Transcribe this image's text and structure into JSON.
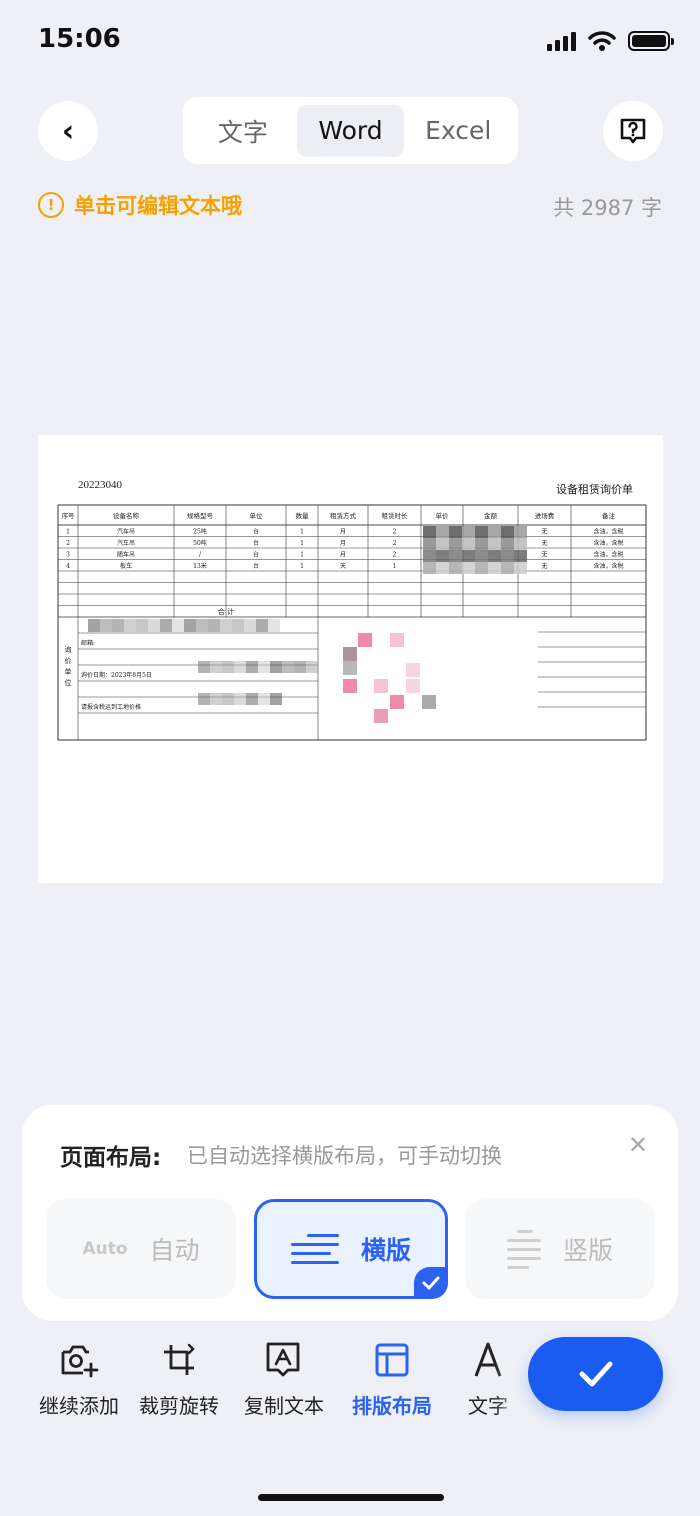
{
  "status": {
    "time": "15:06"
  },
  "header": {
    "tabs": [
      {
        "label": "文字",
        "active": false
      },
      {
        "label": "Word",
        "active": true
      },
      {
        "label": "Excel",
        "active": false
      }
    ]
  },
  "hint": {
    "text": "单击可编辑文本哦",
    "count": "共 2987 字"
  },
  "document": {
    "code": "20223040",
    "title": "设备租赁询价单",
    "headers": [
      "序号",
      "设备名称",
      "规格型号",
      "单位",
      "数量",
      "租赁方式",
      "租赁时长",
      "单价",
      "金额",
      "进场费",
      "备注"
    ],
    "rows": [
      [
        "1",
        "汽车吊",
        "25吨",
        "台",
        "1",
        "月",
        "2",
        "",
        "",
        "无",
        "含油，含税"
      ],
      [
        "2",
        "汽车吊",
        "50吨",
        "台",
        "1",
        "月",
        "2",
        "",
        "",
        "无",
        "含油，含税"
      ],
      [
        "3",
        "随车吊",
        "/",
        "台",
        "1",
        "月",
        "2",
        "",
        "",
        "无",
        "含油，含税"
      ],
      [
        "4",
        "板车",
        "13米",
        "台",
        "1",
        "天",
        "1",
        "",
        "",
        "无",
        "含油，含税"
      ]
    ],
    "total_label": "合      计",
    "inquiry_label": "询价单位",
    "email_label": "邮箱:",
    "date_label": "询价日期：2023年8月5日",
    "note": "请报含税运到工地价格"
  },
  "layout_panel": {
    "title": "页面布局:",
    "subtitle": "已自动选择横版布局，可手动切换",
    "options": [
      {
        "tag": "Auto",
        "label": "自动",
        "selected": false
      },
      {
        "label": "横版",
        "selected": true
      },
      {
        "label": "竖版",
        "selected": false
      }
    ]
  },
  "toolbar": {
    "items": [
      {
        "label": "继续添加",
        "icon": "camera-plus-icon"
      },
      {
        "label": "裁剪旋转",
        "icon": "crop-rotate-icon"
      },
      {
        "label": "复制文本",
        "icon": "copy-text-icon"
      },
      {
        "label": "排版布局",
        "icon": "layout-icon",
        "active": true
      },
      {
        "label": "文字",
        "icon": "font-icon"
      }
    ]
  },
  "colors": {
    "accent": "#2b63f0",
    "warning": "#f5a200",
    "confirm": "#1a5cf0"
  }
}
